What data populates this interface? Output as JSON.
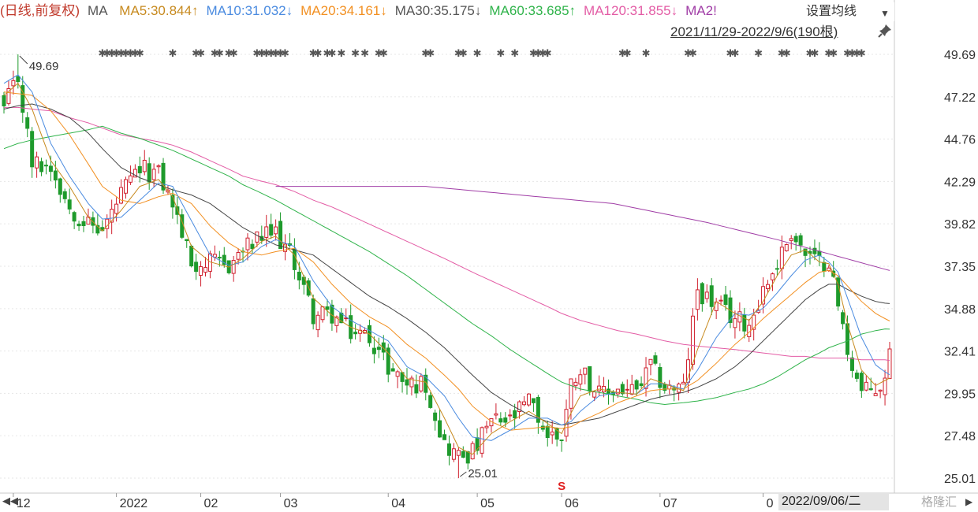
{
  "header": {
    "mode": "(日线,前复权)",
    "ma_label": "MA",
    "items": [
      {
        "text": "MA5:30.844↑",
        "color": "#c78a1f"
      },
      {
        "text": "MA10:31.032↓",
        "color": "#4a8be0"
      },
      {
        "text": "MA20:34.161↓",
        "color": "#f29022"
      },
      {
        "text": "MA30:35.175↓",
        "color": "#555555"
      },
      {
        "text": "MA60:33.685↑",
        "color": "#2fb34a"
      },
      {
        "text": "MA120:31.855↓",
        "color": "#e35ca5"
      },
      {
        "text": "MA2!",
        "color": "#a03da6"
      }
    ],
    "settings_label": "设置均线",
    "range_label": "2021/11/29-2022/9/6(190根)"
  },
  "footer": {
    "nav_left": "◀◀",
    "current_date": "2022/09/06/二",
    "nav_right": "▶",
    "watermark": "格隆汇"
  },
  "colors": {
    "up": "#d0202e",
    "down": "#1e9a2c",
    "ma5": "#c78a1f",
    "ma10": "#4a8be0",
    "ma20": "#f29022",
    "ma30": "#444444",
    "ma60": "#2fb34a",
    "ma120": "#e35ca5",
    "ma250": "#a03da6"
  },
  "chart_data": {
    "type": "candlestick",
    "period": "2021/11/29-2022/9/6",
    "bar_count": 190,
    "ylim": [
      25.01,
      49.69
    ],
    "y_ticks": [
      "49.69",
      "47.22",
      "44.76",
      "42.29",
      "39.82",
      "37.35",
      "34.88",
      "32.41",
      "29.95",
      "27.48",
      "25.01"
    ],
    "x_ticks": [
      {
        "label": "12",
        "index": 2
      },
      {
        "label": "2022",
        "index": 24
      },
      {
        "label": "02",
        "index": 42
      },
      {
        "label": "03",
        "index": 59
      },
      {
        "label": "04",
        "index": 82
      },
      {
        "label": "05",
        "index": 101
      },
      {
        "label": "06",
        "index": 119
      },
      {
        "label": "07",
        "index": 140
      },
      {
        "label": "0",
        "index": 162
      }
    ],
    "high_label": {
      "text": "49.69",
      "value": 49.69,
      "index": 3
    },
    "low_label": {
      "text": "25.01",
      "value": 25.01,
      "index": 97
    },
    "signal_marker": {
      "text": "S",
      "index": 119
    },
    "events_row_indices": [
      21,
      22,
      23,
      24,
      25,
      26,
      27,
      28,
      29,
      36,
      41,
      42,
      45,
      46,
      48,
      49,
      54,
      55,
      56,
      57,
      58,
      59,
      60,
      66,
      67,
      69,
      70,
      72,
      75,
      77,
      80,
      81,
      90,
      91,
      97,
      98,
      101,
      106,
      109,
      113,
      114,
      115,
      116,
      132,
      133,
      137,
      146,
      147,
      155,
      156,
      161,
      166,
      167,
      172,
      173,
      176,
      177,
      180,
      181,
      182,
      183
    ],
    "anchors": [
      {
        "i": 0,
        "c": 46.5,
        "ma5": 47.3,
        "ma10": 48.0,
        "ma20": 47.5,
        "ma30": 46.5,
        "ma60": 44.2,
        "ma120": 46.6
      },
      {
        "i": 3,
        "c": 48.3,
        "ma5": 48.0,
        "ma10": 48.5,
        "ma20": 47.4,
        "ma30": 46.7,
        "ma60": 44.5,
        "ma120": 46.6
      },
      {
        "i": 6,
        "c": 43.3,
        "ma5": 46.5,
        "ma10": 47.5,
        "ma20": 47.3,
        "ma30": 46.8,
        "ma60": 44.7,
        "ma120": 46.5
      },
      {
        "i": 10,
        "c": 43.2,
        "ma5": 43.5,
        "ma10": 44.5,
        "ma20": 46.4,
        "ma30": 46.5,
        "ma60": 44.9,
        "ma120": 46.4
      },
      {
        "i": 14,
        "c": 40.8,
        "ma5": 42.0,
        "ma10": 42.6,
        "ma20": 45.0,
        "ma30": 46.0,
        "ma60": 45.1,
        "ma120": 46.0
      },
      {
        "i": 18,
        "c": 39.8,
        "ma5": 40.2,
        "ma10": 41.0,
        "ma20": 43.3,
        "ma30": 45.1,
        "ma60": 45.3,
        "ma120": 45.7
      },
      {
        "i": 21,
        "c": 39.4,
        "ma5": 39.4,
        "ma10": 40.1,
        "ma20": 42.0,
        "ma30": 44.2,
        "ma60": 45.5,
        "ma120": 45.4
      },
      {
        "i": 25,
        "c": 41.5,
        "ma5": 40.6,
        "ma10": 40.2,
        "ma20": 41.2,
        "ma30": 43.1,
        "ma60": 45.1,
        "ma120": 45.0
      },
      {
        "i": 29,
        "c": 43.0,
        "ma5": 42.0,
        "ma10": 41.2,
        "ma20": 41.0,
        "ma30": 42.5,
        "ma60": 44.8,
        "ma120": 44.8
      },
      {
        "i": 33,
        "c": 42.7,
        "ma5": 42.4,
        "ma10": 42.2,
        "ma20": 41.4,
        "ma30": 42.1,
        "ma60": 44.4,
        "ma120": 44.6
      },
      {
        "i": 36,
        "c": 41.0,
        "ma5": 41.4,
        "ma10": 42.0,
        "ma20": 41.6,
        "ma30": 41.8,
        "ma60": 44.1,
        "ma120": 44.4
      },
      {
        "i": 40,
        "c": 37.5,
        "ma5": 38.5,
        "ma10": 40.0,
        "ma20": 41.0,
        "ma30": 41.5,
        "ma60": 43.6,
        "ma120": 44.0
      },
      {
        "i": 44,
        "c": 37.5,
        "ma5": 37.6,
        "ma10": 38.0,
        "ma20": 39.7,
        "ma30": 41.0,
        "ma60": 43.1,
        "ma120": 43.5
      },
      {
        "i": 48,
        "c": 37.4,
        "ma5": 37.3,
        "ma10": 37.4,
        "ma20": 38.7,
        "ma30": 40.2,
        "ma60": 42.6,
        "ma120": 43.0
      },
      {
        "i": 51,
        "c": 38.3,
        "ma5": 37.8,
        "ma10": 37.6,
        "ma20": 38.2,
        "ma30": 39.6,
        "ma60": 42.1,
        "ma120": 42.6
      },
      {
        "i": 55,
        "c": 39.0,
        "ma5": 38.8,
        "ma10": 38.5,
        "ma20": 38.0,
        "ma30": 39.0,
        "ma60": 41.6,
        "ma120": 42.3
      },
      {
        "i": 58,
        "c": 39.3,
        "ma5": 39.1,
        "ma10": 38.9,
        "ma20": 38.2,
        "ma30": 38.6,
        "ma60": 41.2,
        "ma120": 42.1
      },
      {
        "i": 62,
        "c": 37.6,
        "ma5": 38.0,
        "ma10": 38.5,
        "ma20": 38.4,
        "ma30": 38.3,
        "ma60": 40.6,
        "ma120": 41.7
      },
      {
        "i": 66,
        "c": 34.5,
        "ma5": 35.5,
        "ma10": 36.5,
        "ma20": 37.6,
        "ma30": 38.0,
        "ma60": 40.0,
        "ma120": 41.2
      },
      {
        "i": 70,
        "c": 34.5,
        "ma5": 34.5,
        "ma10": 35.0,
        "ma20": 36.3,
        "ma30": 37.2,
        "ma60": 39.4,
        "ma120": 40.8
      },
      {
        "i": 74,
        "c": 33.5,
        "ma5": 33.8,
        "ma10": 34.2,
        "ma20": 35.2,
        "ma30": 36.4,
        "ma60": 38.8,
        "ma120": 40.3
      },
      {
        "i": 78,
        "c": 33.3,
        "ma5": 33.4,
        "ma10": 33.6,
        "ma20": 34.4,
        "ma30": 35.6,
        "ma60": 38.2,
        "ma120": 39.8
      },
      {
        "i": 82,
        "c": 31.5,
        "ma5": 32.3,
        "ma10": 33.0,
        "ma20": 33.8,
        "ma30": 35.0,
        "ma60": 37.5,
        "ma120": 39.3
      },
      {
        "i": 86,
        "c": 30.5,
        "ma5": 30.8,
        "ma10": 31.5,
        "ma20": 32.8,
        "ma30": 34.3,
        "ma60": 36.8,
        "ma120": 38.8
      },
      {
        "i": 90,
        "c": 30.5,
        "ma5": 30.6,
        "ma10": 30.9,
        "ma20": 32.0,
        "ma30": 33.5,
        "ma60": 36.0,
        "ma120": 38.3
      },
      {
        "i": 94,
        "c": 27.0,
        "ma5": 28.5,
        "ma10": 29.8,
        "ma20": 31.0,
        "ma30": 32.6,
        "ma60": 35.2,
        "ma120": 37.8
      },
      {
        "i": 97,
        "c": 26.3,
        "ma5": 26.8,
        "ma10": 28.5,
        "ma20": 30.2,
        "ma30": 31.8,
        "ma60": 34.6,
        "ma120": 37.4
      },
      {
        "i": 100,
        "c": 26.5,
        "ma5": 26.4,
        "ma10": 27.4,
        "ma20": 29.2,
        "ma30": 31.0,
        "ma60": 34.0,
        "ma120": 37.0
      },
      {
        "i": 104,
        "c": 28.3,
        "ma5": 27.6,
        "ma10": 27.2,
        "ma20": 28.3,
        "ma30": 30.0,
        "ma60": 33.3,
        "ma120": 36.5
      },
      {
        "i": 108,
        "c": 28.3,
        "ma5": 28.3,
        "ma10": 27.8,
        "ma20": 27.8,
        "ma30": 29.3,
        "ma60": 32.5,
        "ma120": 36.0
      },
      {
        "i": 112,
        "c": 29.5,
        "ma5": 28.9,
        "ma10": 28.5,
        "ma20": 27.9,
        "ma30": 28.7,
        "ma60": 31.8,
        "ma120": 35.5
      },
      {
        "i": 116,
        "c": 27.5,
        "ma5": 28.2,
        "ma10": 28.5,
        "ma20": 28.0,
        "ma30": 28.3,
        "ma60": 31.1,
        "ma120": 35.0
      },
      {
        "i": 119,
        "c": 27.5,
        "ma5": 27.6,
        "ma10": 28.1,
        "ma20": 27.9,
        "ma30": 28.1,
        "ma60": 30.6,
        "ma120": 34.6
      },
      {
        "i": 121,
        "c": 30.5,
        "ma5": 28.8,
        "ma10": 28.3,
        "ma20": 28.0,
        "ma30": 28.2,
        "ma60": 30.4,
        "ma120": 34.4
      },
      {
        "i": 123,
        "c": 31.5,
        "ma5": 29.8,
        "ma10": 28.9,
        "ma20": 28.3,
        "ma30": 28.3,
        "ma60": 30.2,
        "ma120": 34.2
      },
      {
        "i": 127,
        "c": 29.8,
        "ma5": 30.2,
        "ma10": 29.8,
        "ma20": 28.8,
        "ma30": 28.5,
        "ma60": 30.0,
        "ma120": 33.9
      },
      {
        "i": 131,
        "c": 30.2,
        "ma5": 30.0,
        "ma10": 30.0,
        "ma20": 29.4,
        "ma30": 28.9,
        "ma60": 29.8,
        "ma120": 33.6
      },
      {
        "i": 135,
        "c": 30.0,
        "ma5": 29.9,
        "ma10": 29.9,
        "ma20": 29.8,
        "ma30": 29.3,
        "ma60": 29.6,
        "ma120": 33.4
      },
      {
        "i": 138,
        "c": 31.5,
        "ma5": 30.8,
        "ma10": 30.5,
        "ma20": 30.1,
        "ma30": 29.6,
        "ma60": 29.4,
        "ma120": 33.2
      },
      {
        "i": 141,
        "c": 30.3,
        "ma5": 30.5,
        "ma10": 30.5,
        "ma20": 30.2,
        "ma30": 29.8,
        "ma60": 29.3,
        "ma120": 33.0
      },
      {
        "i": 145,
        "c": 30.2,
        "ma5": 30.1,
        "ma10": 30.2,
        "ma20": 30.2,
        "ma30": 30.0,
        "ma60": 29.4,
        "ma120": 32.8
      },
      {
        "i": 148,
        "c": 36.0,
        "ma5": 32.5,
        "ma10": 31.3,
        "ma20": 30.7,
        "ma30": 30.3,
        "ma60": 29.5,
        "ma120": 32.7
      },
      {
        "i": 152,
        "c": 35.0,
        "ma5": 35.3,
        "ma10": 33.2,
        "ma20": 31.7,
        "ma30": 30.8,
        "ma60": 29.7,
        "ma120": 32.6
      },
      {
        "i": 156,
        "c": 34.3,
        "ma5": 34.6,
        "ma10": 34.6,
        "ma20": 32.8,
        "ma30": 31.5,
        "ma60": 30.0,
        "ma120": 32.5
      },
      {
        "i": 159,
        "c": 34.0,
        "ma5": 34.2,
        "ma10": 34.5,
        "ma20": 33.5,
        "ma30": 32.2,
        "ma60": 30.2,
        "ma120": 32.4
      },
      {
        "i": 162,
        "c": 36.0,
        "ma5": 35.3,
        "ma10": 34.9,
        "ma20": 34.3,
        "ma30": 33.0,
        "ma60": 30.5,
        "ma120": 32.3
      },
      {
        "i": 165,
        "c": 37.5,
        "ma5": 36.8,
        "ma10": 35.8,
        "ma20": 35.0,
        "ma30": 33.8,
        "ma60": 30.9,
        "ma120": 32.2
      },
      {
        "i": 168,
        "c": 39.4,
        "ma5": 38.0,
        "ma10": 36.8,
        "ma20": 35.7,
        "ma30": 34.6,
        "ma60": 31.4,
        "ma120": 32.1
      },
      {
        "i": 171,
        "c": 38.0,
        "ma5": 38.3,
        "ma10": 37.7,
        "ma20": 36.4,
        "ma30": 35.4,
        "ma60": 31.9,
        "ma120": 32.1
      },
      {
        "i": 174,
        "c": 37.5,
        "ma5": 37.6,
        "ma10": 38.0,
        "ma20": 37.0,
        "ma30": 36.0,
        "ma60": 32.3,
        "ma120": 32.0
      },
      {
        "i": 176,
        "c": 37.8,
        "ma5": 37.5,
        "ma10": 37.6,
        "ma20": 37.1,
        "ma30": 36.3,
        "ma60": 32.6,
        "ma120": 32.0
      },
      {
        "i": 178,
        "c": 35.0,
        "ma5": 36.3,
        "ma10": 37.0,
        "ma20": 36.8,
        "ma30": 36.3,
        "ma60": 32.8,
        "ma120": 32.0
      },
      {
        "i": 180,
        "c": 32.5,
        "ma5": 34.0,
        "ma10": 35.5,
        "ma20": 36.2,
        "ma30": 36.0,
        "ma60": 33.0,
        "ma120": 32.0
      },
      {
        "i": 183,
        "c": 30.0,
        "ma5": 31.3,
        "ma10": 33.2,
        "ma20": 35.3,
        "ma30": 35.6,
        "ma60": 33.4,
        "ma120": 31.9
      },
      {
        "i": 186,
        "c": 30.2,
        "ma5": 30.4,
        "ma10": 31.6,
        "ma20": 34.6,
        "ma30": 35.3,
        "ma60": 33.6,
        "ma120": 31.9
      },
      {
        "i": 188,
        "c": 30.5,
        "ma5": 30.7,
        "ma10": 31.2,
        "ma20": 34.3,
        "ma30": 35.2,
        "ma60": 33.7,
        "ma120": 31.9
      },
      {
        "i": 189,
        "c": 33.0,
        "ma5": 30.844,
        "ma10": 31.032,
        "ma20": 34.161,
        "ma30": 35.175,
        "ma60": 33.685,
        "ma120": 31.855
      }
    ],
    "ma250": [
      {
        "i": 58,
        "v": 42.0
      },
      {
        "i": 70,
        "v": 42.0
      },
      {
        "i": 90,
        "v": 42.0
      },
      {
        "i": 110,
        "v": 41.5
      },
      {
        "i": 130,
        "v": 41.0
      },
      {
        "i": 150,
        "v": 39.9
      },
      {
        "i": 165,
        "v": 38.9
      },
      {
        "i": 189,
        "v": 37.1
      }
    ]
  }
}
